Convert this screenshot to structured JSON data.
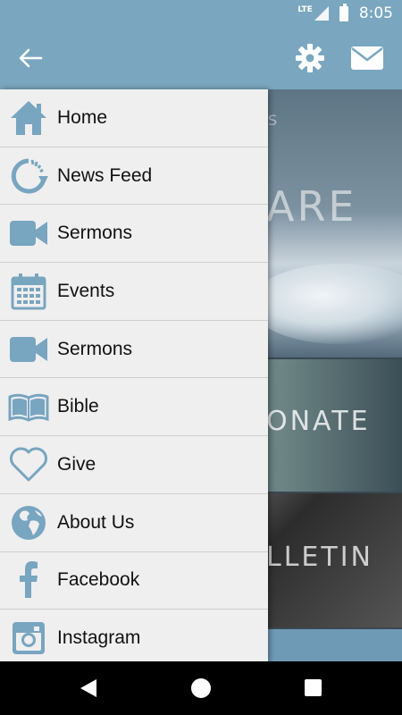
{
  "status_bar": {
    "network": "LTE",
    "time": "8:05"
  },
  "app_bar": {
    "colors": {
      "bar": "#7aa7bf",
      "icon": "#ffffff"
    }
  },
  "background_tiles": {
    "tile1_subtitle": "S",
    "tile1_title": "ARE",
    "tile2_title": "ONATE",
    "tile3_title": "LLETIN"
  },
  "drawer": {
    "icon_color": "#78a5c0",
    "items": [
      {
        "label": "Home",
        "icon": "home-icon"
      },
      {
        "label": "News Feed",
        "icon": "refresh-icon"
      },
      {
        "label": "Sermons",
        "icon": "video-camera-icon"
      },
      {
        "label": "Events",
        "icon": "calendar-icon"
      },
      {
        "label": "Sermons",
        "icon": "video-camera-icon"
      },
      {
        "label": "Bible",
        "icon": "book-icon"
      },
      {
        "label": "Give",
        "icon": "heart-icon"
      },
      {
        "label": "About Us",
        "icon": "globe-icon"
      },
      {
        "label": "Facebook",
        "icon": "facebook-icon"
      },
      {
        "label": "Instagram",
        "icon": "instagram-icon"
      }
    ]
  }
}
